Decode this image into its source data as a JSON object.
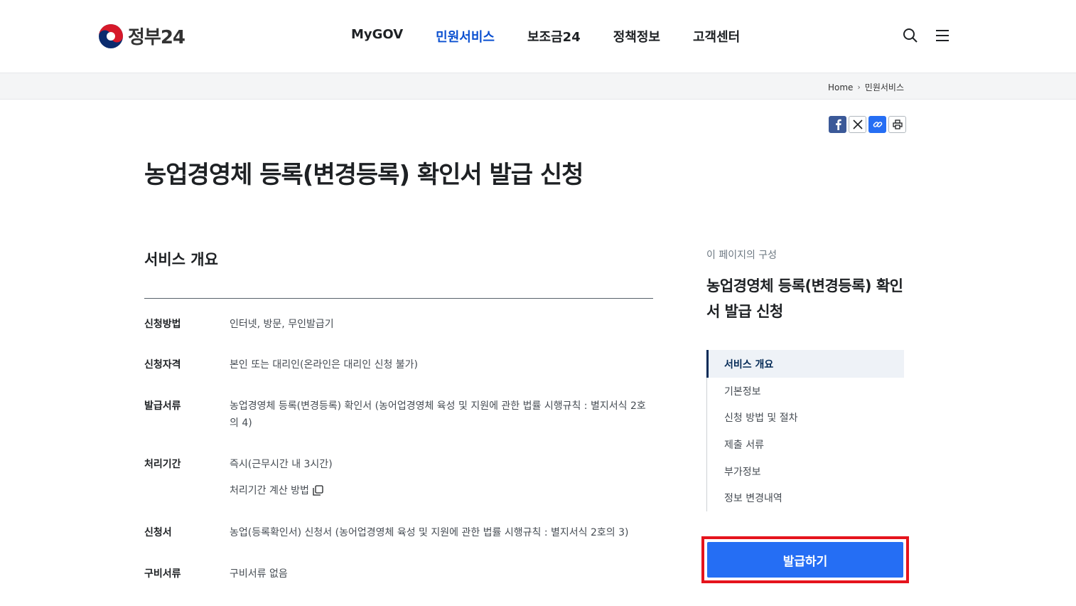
{
  "header": {
    "logo_text": "정부24",
    "nav": [
      "MyGOV",
      "민원서비스",
      "보조금24",
      "정책정보",
      "고객센터"
    ],
    "active_nav": "민원서비스"
  },
  "breadcrumb": {
    "home": "Home",
    "current": "민원서비스"
  },
  "page_title": "농업경영체 등록(변경등록) 확인서 발급 신청",
  "overview": {
    "title": "서비스 개요",
    "rows": [
      {
        "label": "신청방법",
        "value": "인터넷, 방문, 무인발급기"
      },
      {
        "label": "신청자격",
        "value": "본인 또는 대리인(온라인은 대리인 신청 불가)"
      },
      {
        "label": "발급서류",
        "value": "농업경영체 등록(변경등록) 확인서 (농어업경영체 육성 및 지원에 관한 법률 시행규칙 : 별지서식 2호의 4)"
      },
      {
        "label": "처리기간",
        "value": "즉시(근무시간 내 3시간)",
        "sub_link": "처리기간 계산 방법"
      },
      {
        "label": "신청서",
        "value": "농업(등록확인서) 신청서 (농어업경영체 육성 및 지원에 관한 법률 시행규칙 : 별지서식 2호의 3)"
      },
      {
        "label": "구비서류",
        "value": "구비서류 없음"
      }
    ]
  },
  "toc": {
    "caption": "이 페이지의 구성",
    "title": "농업경영체 등록(변경등록) 확인서 발급 신청",
    "items": [
      "서비스 개요",
      "기본정보",
      "신청 방법 및 절차",
      "제출 서류",
      "부가정보",
      "정보 변경내역"
    ],
    "active": "서비스 개요"
  },
  "issue_button": "발급하기",
  "colors": {
    "primary": "#256ef4",
    "active_nav": "#0b50d0",
    "highlight": "#e5141d"
  }
}
